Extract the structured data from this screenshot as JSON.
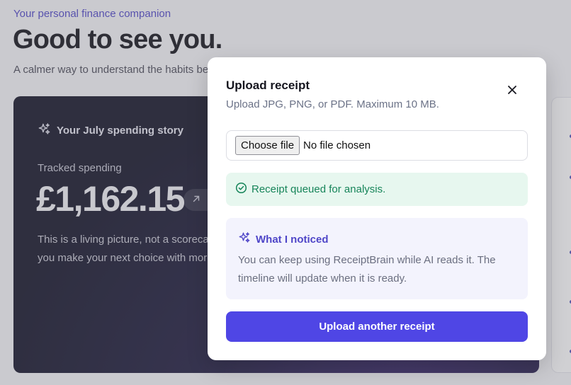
{
  "page": {
    "tagline": "Your personal finance companion",
    "heading": "Good to see you.",
    "subheading": "A calmer way to understand the habits behind your money."
  },
  "story_card": {
    "title": "Your July spending story",
    "tracked_label": "Tracked spending",
    "tracked_amount": "£1,162.15",
    "body_line1": "This is a living picture, not a scorecard, to help",
    "body_line2": "you make your next choice with more confidence."
  },
  "modal": {
    "title": "Upload receipt",
    "subtitle": "Upload JPG, PNG, or PDF. Maximum 10 MB.",
    "file_button_label": "Choose file",
    "file_status": "No file chosen",
    "success_message": "Receipt queued for analysis.",
    "notice_title": "What I noticed",
    "notice_body": "You can keep using ReceiptBrain while AI reads it. The timeline will update when it is ready.",
    "primary_button_label": "Upload another receipt"
  },
  "colors": {
    "accent": "#4f46e5",
    "success": "#17855a",
    "success_bg": "#e7f7ef",
    "notice_bg": "#f3f3fd"
  },
  "icons": {
    "story": "sparkles-icon",
    "trend": "arrow-up-right-icon",
    "close": "close-icon",
    "success": "check-circle-icon",
    "notice": "sparkles-icon"
  }
}
